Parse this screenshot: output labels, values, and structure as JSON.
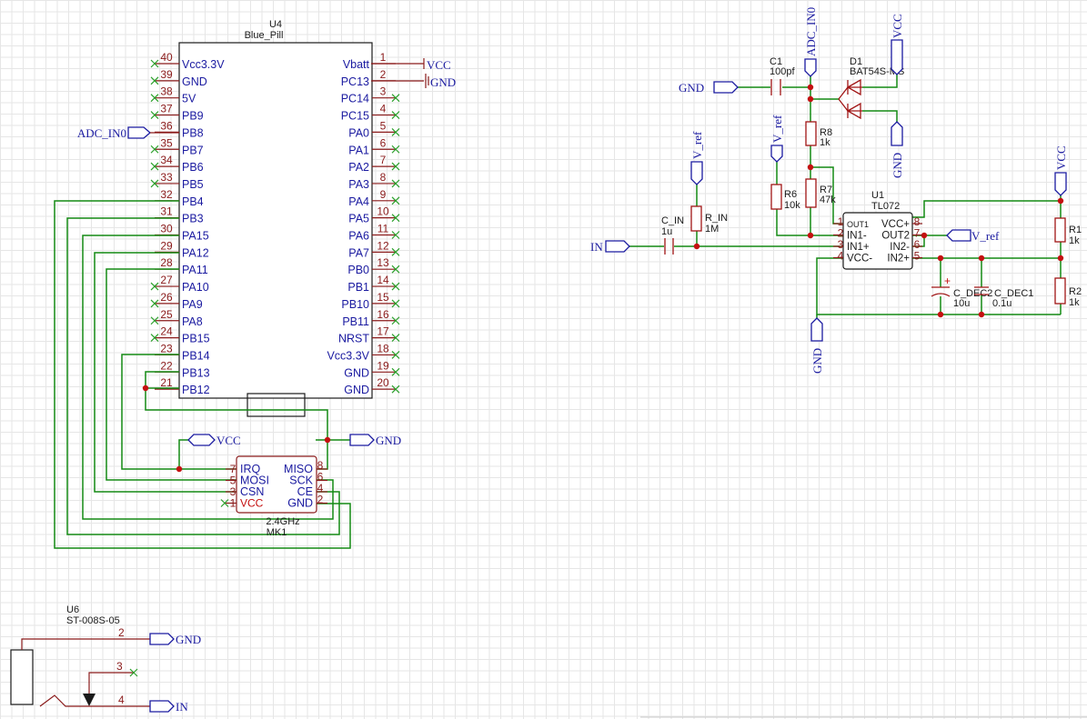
{
  "u4": {
    "ref": "U4",
    "value": "Blue_Pill",
    "left_pins": [
      {
        "num": "40",
        "name": "Vcc3.3V"
      },
      {
        "num": "39",
        "name": "GND"
      },
      {
        "num": "38",
        "name": "5V"
      },
      {
        "num": "37",
        "name": "PB9"
      },
      {
        "num": "36",
        "name": "PB8"
      },
      {
        "num": "35",
        "name": "PB7"
      },
      {
        "num": "34",
        "name": "PB6"
      },
      {
        "num": "33",
        "name": "PB5"
      },
      {
        "num": "32",
        "name": "PB4"
      },
      {
        "num": "31",
        "name": "PB3"
      },
      {
        "num": "30",
        "name": "PA15"
      },
      {
        "num": "29",
        "name": "PA12"
      },
      {
        "num": "28",
        "name": "PA11"
      },
      {
        "num": "27",
        "name": "PA10"
      },
      {
        "num": "26",
        "name": "PA9"
      },
      {
        "num": "25",
        "name": "PA8"
      },
      {
        "num": "24",
        "name": "PB15"
      },
      {
        "num": "23",
        "name": "PB14"
      },
      {
        "num": "22",
        "name": "PB13"
      },
      {
        "num": "21",
        "name": "PB12"
      }
    ],
    "right_pins": [
      {
        "num": "1",
        "name": "Vbatt"
      },
      {
        "num": "2",
        "name": "PC13"
      },
      {
        "num": "3",
        "name": "PC14"
      },
      {
        "num": "4",
        "name": "PC15"
      },
      {
        "num": "5",
        "name": "PA0"
      },
      {
        "num": "6",
        "name": "PA1"
      },
      {
        "num": "7",
        "name": "PA2"
      },
      {
        "num": "8",
        "name": "PA3"
      },
      {
        "num": "9",
        "name": "PA4"
      },
      {
        "num": "10",
        "name": "PA5"
      },
      {
        "num": "11",
        "name": "PA6"
      },
      {
        "num": "12",
        "name": "PA7"
      },
      {
        "num": "13",
        "name": "PB0"
      },
      {
        "num": "14",
        "name": "PB1"
      },
      {
        "num": "15",
        "name": "PB10"
      },
      {
        "num": "16",
        "name": "PB11"
      },
      {
        "num": "17",
        "name": "NRST"
      },
      {
        "num": "18",
        "name": "Vcc3.3V"
      },
      {
        "num": "19",
        "name": "GND"
      },
      {
        "num": "20",
        "name": "GND"
      }
    ]
  },
  "mk1": {
    "ref": "MK1",
    "value": "2.4GHz",
    "left_pins": [
      {
        "num": "7",
        "name": "IRQ"
      },
      {
        "num": "5",
        "name": "MOSI"
      },
      {
        "num": "3",
        "name": "CSN"
      },
      {
        "num": "1",
        "name": "VCC"
      }
    ],
    "right_pins": [
      {
        "num": "8",
        "name": "MISO"
      },
      {
        "num": "6",
        "name": "SCK"
      },
      {
        "num": "4",
        "name": "CE"
      },
      {
        "num": "2",
        "name": "GND"
      }
    ]
  },
  "u6": {
    "ref": "U6",
    "value": "ST-008S-05",
    "pins": [
      {
        "num": "2"
      },
      {
        "num": "3"
      },
      {
        "num": "4"
      }
    ]
  },
  "u1": {
    "ref": "U1",
    "value": "TL072",
    "left_pins": [
      {
        "num": "1",
        "name": "OUT1"
      },
      {
        "num": "2",
        "name": "IN1-"
      },
      {
        "num": "3",
        "name": "IN1+"
      },
      {
        "num": "4",
        "name": "VCC-"
      }
    ],
    "right_pins": [
      {
        "num": "8",
        "name": "VCC+"
      },
      {
        "num": "7",
        "name": "OUT2"
      },
      {
        "num": "6",
        "name": "IN2-"
      },
      {
        "num": "5",
        "name": "IN2+"
      }
    ]
  },
  "components": {
    "c1": {
      "ref": "C1",
      "value": "100pf"
    },
    "d1": {
      "ref": "D1",
      "value": "BAT54S-MS"
    },
    "r8": {
      "ref": "R8",
      "value": "1k"
    },
    "r7": {
      "ref": "R7",
      "value": "47k"
    },
    "r6": {
      "ref": "R6",
      "value": "10k"
    },
    "r_in": {
      "ref": "R_IN",
      "value": "1M"
    },
    "c_in": {
      "ref": "C_IN",
      "value": "1u"
    },
    "r1": {
      "ref": "R1",
      "value": "1k"
    },
    "r2": {
      "ref": "R2",
      "value": "1k"
    },
    "c_dec2": {
      "ref": "C_DEC2",
      "value": "10u"
    },
    "c_dec1": {
      "ref": "C_DEC1",
      "value": "0.1u"
    }
  },
  "nets": {
    "vcc": "VCC",
    "gnd": "GND",
    "adc_in0": "ADC_IN0",
    "v_ref": "V_ref",
    "in": "IN"
  },
  "colors": {
    "wire": "#138a13",
    "pin": "#8a1a1a",
    "label": "#1a1aa0",
    "junction": "#c41010"
  }
}
